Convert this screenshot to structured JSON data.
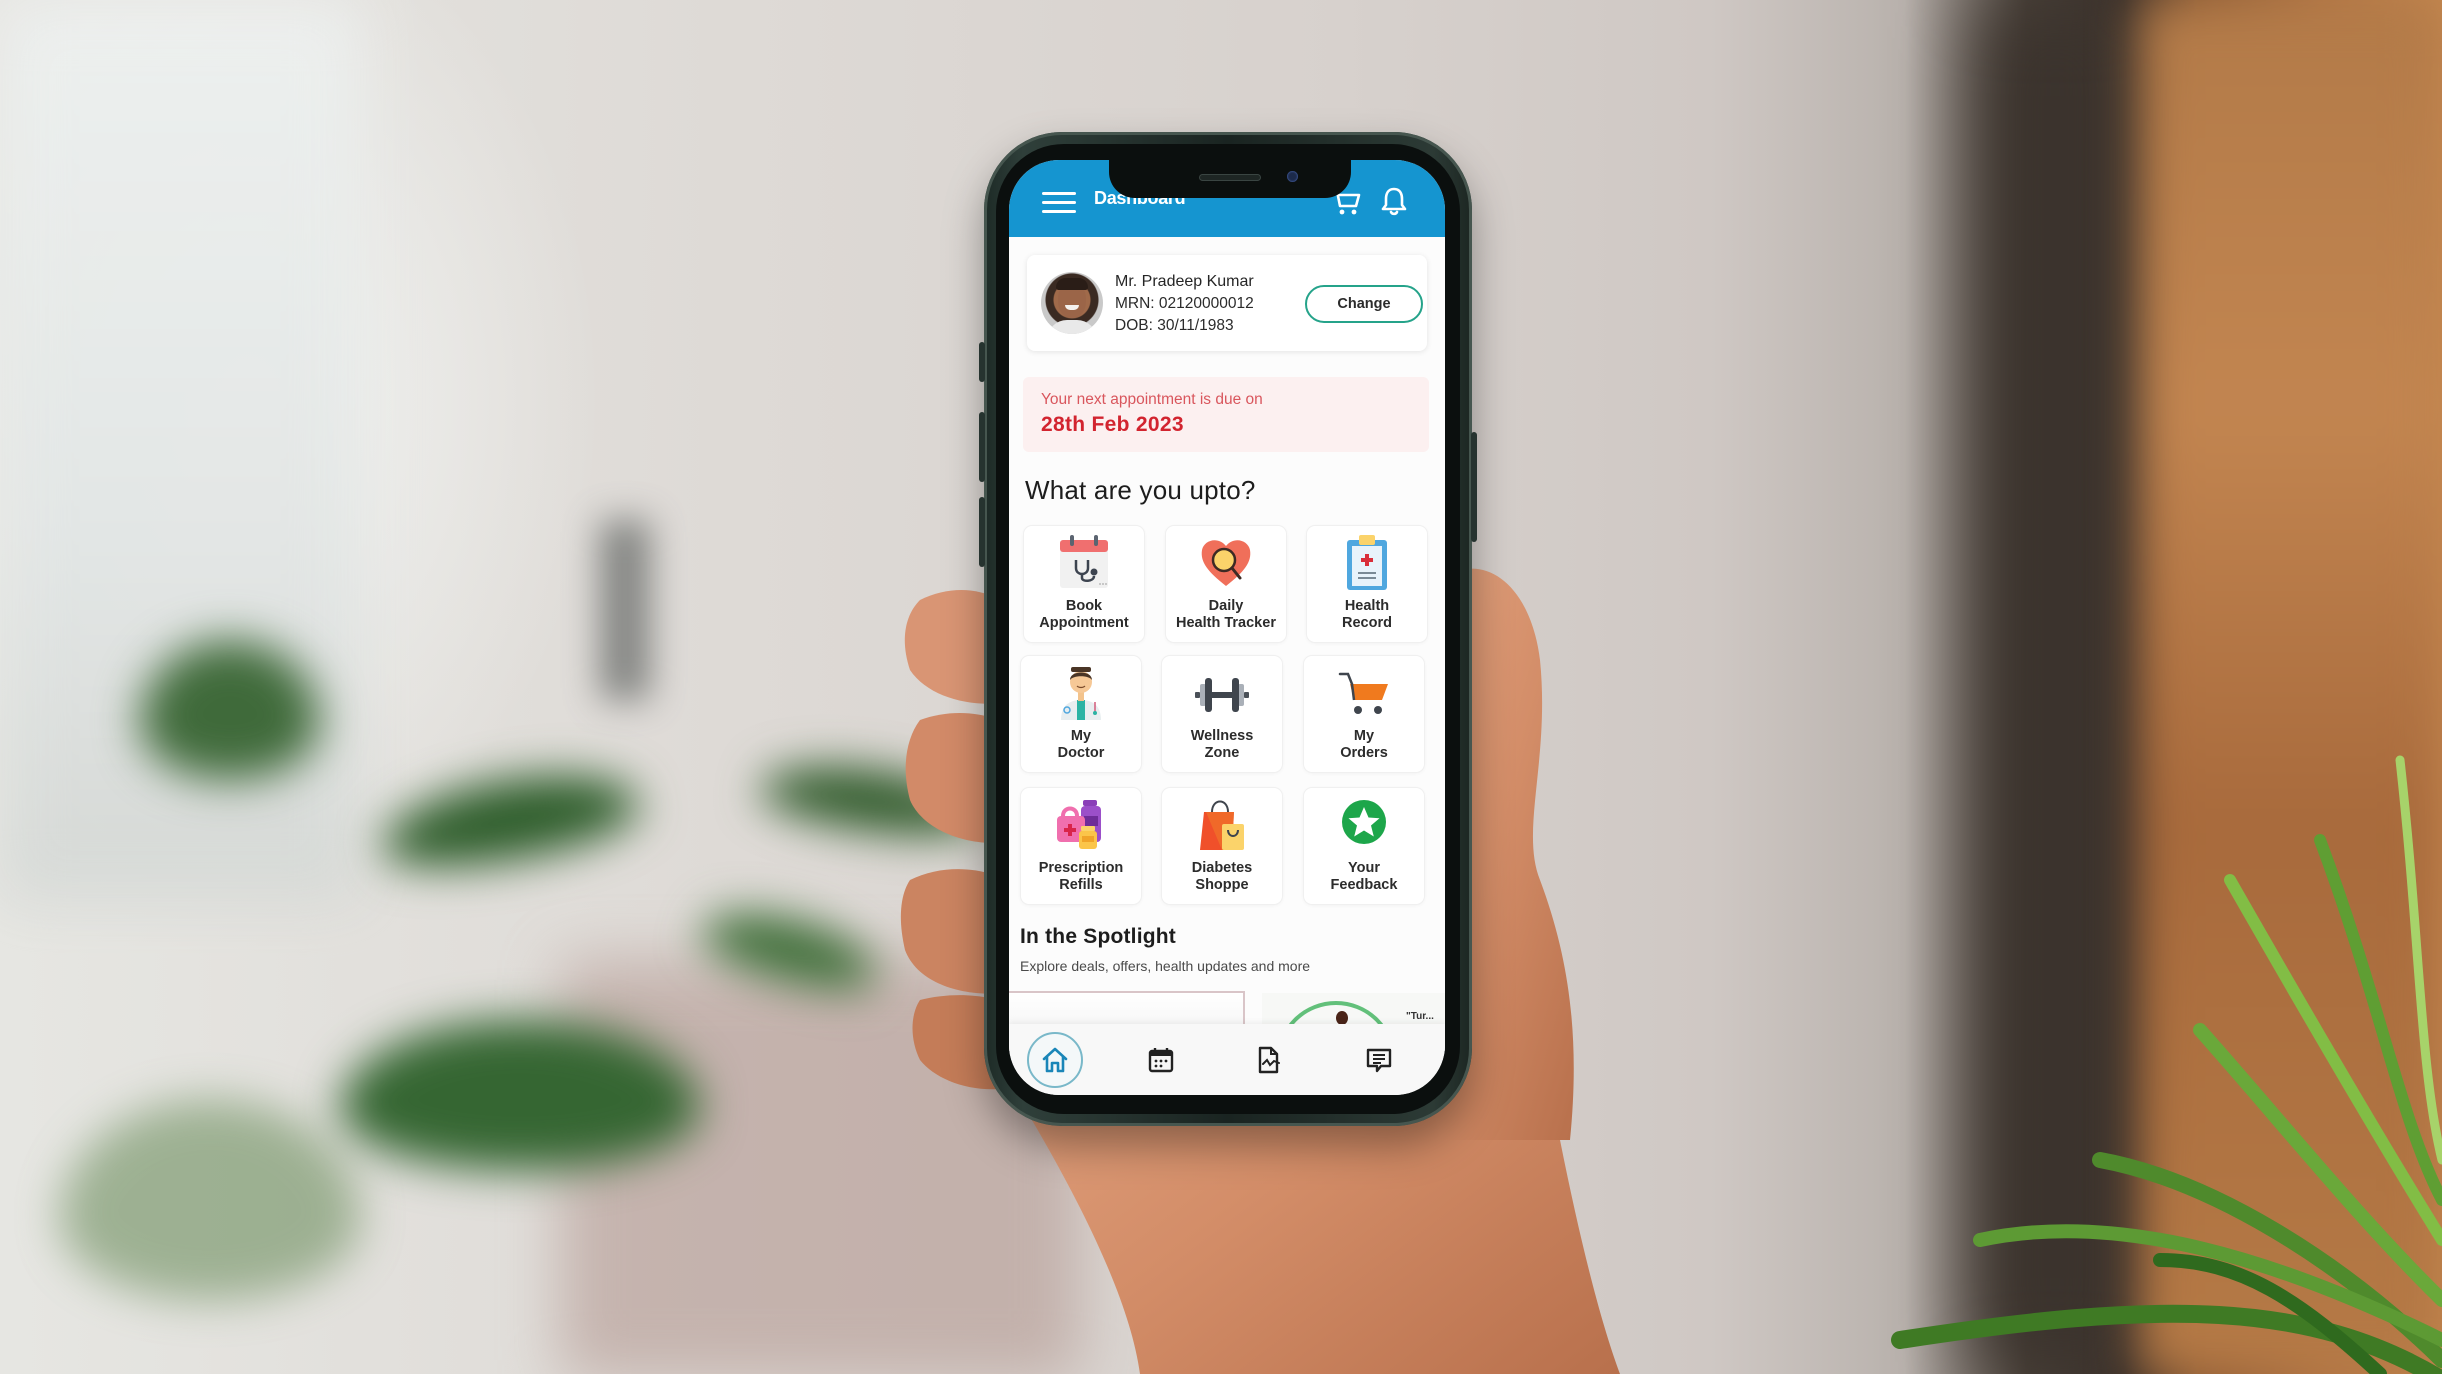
{
  "header": {
    "title": "Dashboard",
    "icons": [
      "menu-icon",
      "cart-icon",
      "bell-icon"
    ]
  },
  "profile": {
    "name": "Mr. Pradeep Kumar",
    "mrn": "MRN: 02120000012",
    "dob": "DOB: 30/11/1983",
    "change_label": "Change"
  },
  "appointment": {
    "label": "Your next appointment is due on",
    "date": "28th Feb  2023"
  },
  "quick_actions": {
    "title": "What are you upto?",
    "items": [
      {
        "label": "Book\nAppointment",
        "icon": "calendar-stethoscope-icon"
      },
      {
        "label": "Daily\nHealth Tracker",
        "icon": "heart-magnifier-icon"
      },
      {
        "label": "Health\nRecord",
        "icon": "clipboard-icon"
      },
      {
        "label": "My\nDoctor",
        "icon": "doctor-icon"
      },
      {
        "label": "Wellness\nZone",
        "icon": "dumbbell-icon"
      },
      {
        "label": "My\nOrders",
        "icon": "shopping-cart-icon"
      },
      {
        "label": "Prescription\nRefills",
        "icon": "medicine-bottles-icon"
      },
      {
        "label": "Diabetes\nShoppe",
        "icon": "shopping-bags-icon"
      },
      {
        "label": "Your\nFeedback",
        "icon": "star-badge-icon"
      }
    ]
  },
  "spotlight": {
    "title": "In the Spotlight",
    "subtitle": "Explore deals, offers, health updates and more",
    "card_2_text": "\"Tur..."
  },
  "bottom_nav": {
    "items": [
      {
        "name": "home",
        "icon": "home-icon",
        "active": true
      },
      {
        "name": "appointments",
        "icon": "calendar-icon",
        "active": false
      },
      {
        "name": "reports",
        "icon": "document-chart-icon",
        "active": false
      },
      {
        "name": "messages",
        "icon": "message-icon",
        "active": false
      }
    ]
  },
  "colors": {
    "header": "#1595d0",
    "accent_green": "#25a38a",
    "appointment_red": "#d2242f",
    "appointment_bg": "#fcf0f0"
  }
}
